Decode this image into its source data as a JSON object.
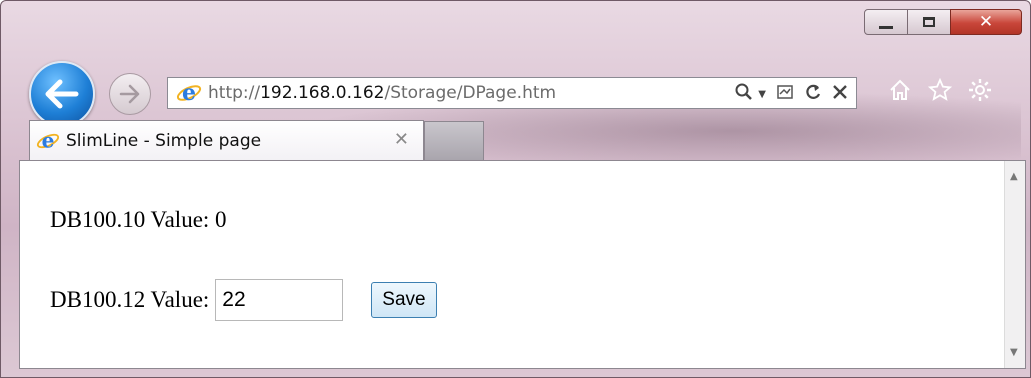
{
  "window": {
    "caption_buttons": {
      "minimize": "minimize",
      "maximize": "maximize",
      "close": "close"
    }
  },
  "address_bar": {
    "url_prefix": "http://",
    "url_host": "192.168.0.162",
    "url_path": "/Storage/DPage.htm"
  },
  "tab": {
    "title": "SlimLine - Simple page",
    "close_glyph": "✕"
  },
  "page": {
    "row1_label": "DB100.10 Value: 0",
    "row2_label": "DB100.12 Value:",
    "row2_input_value": "22",
    "save_label": "Save"
  },
  "colors": {
    "back_button": "#1e7fd6",
    "close_button": "#c9463a",
    "ie_logo": "#2b7be0",
    "save_button_border": "#3c7fb1"
  }
}
